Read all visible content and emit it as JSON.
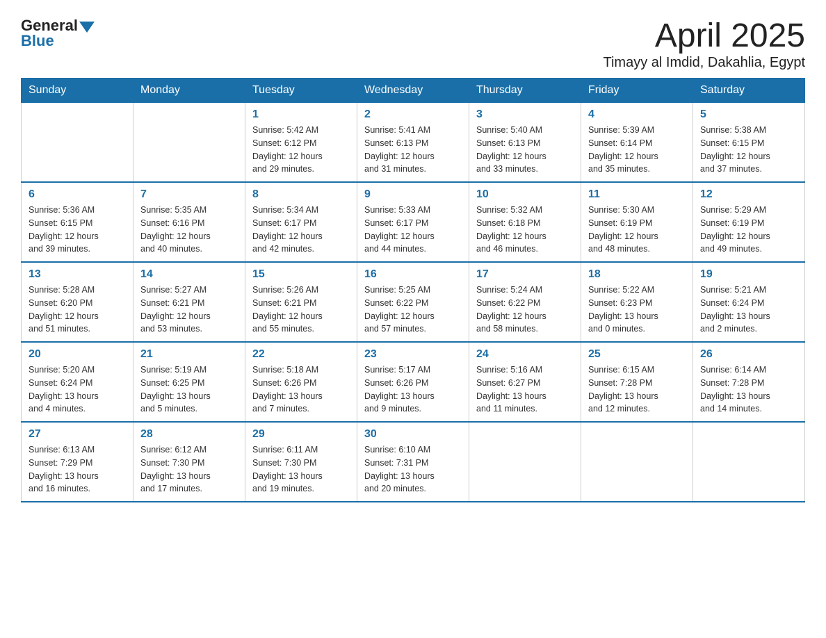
{
  "header": {
    "logo_general": "General",
    "logo_blue": "Blue",
    "title": "April 2025",
    "subtitle": "Timayy al Imdid, Dakahlia, Egypt"
  },
  "days_of_week": [
    "Sunday",
    "Monday",
    "Tuesday",
    "Wednesday",
    "Thursday",
    "Friday",
    "Saturday"
  ],
  "weeks": [
    [
      {
        "num": "",
        "info": ""
      },
      {
        "num": "",
        "info": ""
      },
      {
        "num": "1",
        "info": "Sunrise: 5:42 AM\nSunset: 6:12 PM\nDaylight: 12 hours\nand 29 minutes."
      },
      {
        "num": "2",
        "info": "Sunrise: 5:41 AM\nSunset: 6:13 PM\nDaylight: 12 hours\nand 31 minutes."
      },
      {
        "num": "3",
        "info": "Sunrise: 5:40 AM\nSunset: 6:13 PM\nDaylight: 12 hours\nand 33 minutes."
      },
      {
        "num": "4",
        "info": "Sunrise: 5:39 AM\nSunset: 6:14 PM\nDaylight: 12 hours\nand 35 minutes."
      },
      {
        "num": "5",
        "info": "Sunrise: 5:38 AM\nSunset: 6:15 PM\nDaylight: 12 hours\nand 37 minutes."
      }
    ],
    [
      {
        "num": "6",
        "info": "Sunrise: 5:36 AM\nSunset: 6:15 PM\nDaylight: 12 hours\nand 39 minutes."
      },
      {
        "num": "7",
        "info": "Sunrise: 5:35 AM\nSunset: 6:16 PM\nDaylight: 12 hours\nand 40 minutes."
      },
      {
        "num": "8",
        "info": "Sunrise: 5:34 AM\nSunset: 6:17 PM\nDaylight: 12 hours\nand 42 minutes."
      },
      {
        "num": "9",
        "info": "Sunrise: 5:33 AM\nSunset: 6:17 PM\nDaylight: 12 hours\nand 44 minutes."
      },
      {
        "num": "10",
        "info": "Sunrise: 5:32 AM\nSunset: 6:18 PM\nDaylight: 12 hours\nand 46 minutes."
      },
      {
        "num": "11",
        "info": "Sunrise: 5:30 AM\nSunset: 6:19 PM\nDaylight: 12 hours\nand 48 minutes."
      },
      {
        "num": "12",
        "info": "Sunrise: 5:29 AM\nSunset: 6:19 PM\nDaylight: 12 hours\nand 49 minutes."
      }
    ],
    [
      {
        "num": "13",
        "info": "Sunrise: 5:28 AM\nSunset: 6:20 PM\nDaylight: 12 hours\nand 51 minutes."
      },
      {
        "num": "14",
        "info": "Sunrise: 5:27 AM\nSunset: 6:21 PM\nDaylight: 12 hours\nand 53 minutes."
      },
      {
        "num": "15",
        "info": "Sunrise: 5:26 AM\nSunset: 6:21 PM\nDaylight: 12 hours\nand 55 minutes."
      },
      {
        "num": "16",
        "info": "Sunrise: 5:25 AM\nSunset: 6:22 PM\nDaylight: 12 hours\nand 57 minutes."
      },
      {
        "num": "17",
        "info": "Sunrise: 5:24 AM\nSunset: 6:22 PM\nDaylight: 12 hours\nand 58 minutes."
      },
      {
        "num": "18",
        "info": "Sunrise: 5:22 AM\nSunset: 6:23 PM\nDaylight: 13 hours\nand 0 minutes."
      },
      {
        "num": "19",
        "info": "Sunrise: 5:21 AM\nSunset: 6:24 PM\nDaylight: 13 hours\nand 2 minutes."
      }
    ],
    [
      {
        "num": "20",
        "info": "Sunrise: 5:20 AM\nSunset: 6:24 PM\nDaylight: 13 hours\nand 4 minutes."
      },
      {
        "num": "21",
        "info": "Sunrise: 5:19 AM\nSunset: 6:25 PM\nDaylight: 13 hours\nand 5 minutes."
      },
      {
        "num": "22",
        "info": "Sunrise: 5:18 AM\nSunset: 6:26 PM\nDaylight: 13 hours\nand 7 minutes."
      },
      {
        "num": "23",
        "info": "Sunrise: 5:17 AM\nSunset: 6:26 PM\nDaylight: 13 hours\nand 9 minutes."
      },
      {
        "num": "24",
        "info": "Sunrise: 5:16 AM\nSunset: 6:27 PM\nDaylight: 13 hours\nand 11 minutes."
      },
      {
        "num": "25",
        "info": "Sunrise: 6:15 AM\nSunset: 7:28 PM\nDaylight: 13 hours\nand 12 minutes."
      },
      {
        "num": "26",
        "info": "Sunrise: 6:14 AM\nSunset: 7:28 PM\nDaylight: 13 hours\nand 14 minutes."
      }
    ],
    [
      {
        "num": "27",
        "info": "Sunrise: 6:13 AM\nSunset: 7:29 PM\nDaylight: 13 hours\nand 16 minutes."
      },
      {
        "num": "28",
        "info": "Sunrise: 6:12 AM\nSunset: 7:30 PM\nDaylight: 13 hours\nand 17 minutes."
      },
      {
        "num": "29",
        "info": "Sunrise: 6:11 AM\nSunset: 7:30 PM\nDaylight: 13 hours\nand 19 minutes."
      },
      {
        "num": "30",
        "info": "Sunrise: 6:10 AM\nSunset: 7:31 PM\nDaylight: 13 hours\nand 20 minutes."
      },
      {
        "num": "",
        "info": ""
      },
      {
        "num": "",
        "info": ""
      },
      {
        "num": "",
        "info": ""
      }
    ]
  ]
}
